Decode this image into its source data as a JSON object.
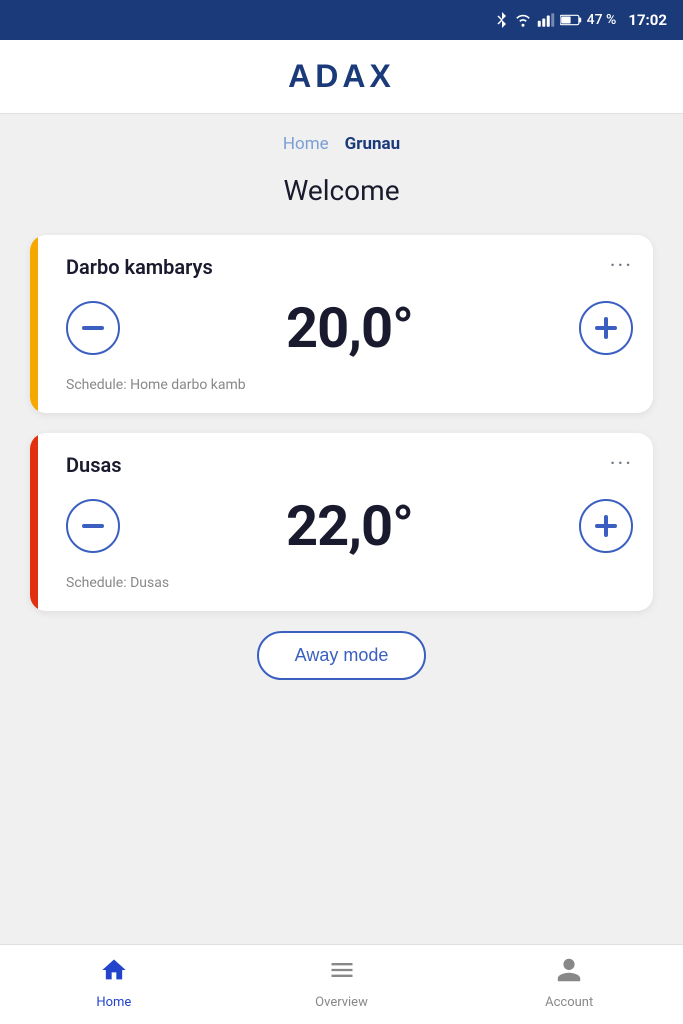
{
  "statusBar": {
    "battery": "47 %",
    "time": "17:02"
  },
  "header": {
    "logo": "ADAX"
  },
  "breadcrumb": {
    "items": [
      {
        "label": "Home",
        "active": false
      },
      {
        "label": "Grunau",
        "active": true
      }
    ]
  },
  "welcome": {
    "title": "Welcome"
  },
  "devices": [
    {
      "id": "device-1",
      "name": "Darbo kambarys",
      "temperature": "20,0°",
      "schedule": "Schedule: Home darbo kamb",
      "accentColor": "#f5a800"
    },
    {
      "id": "device-2",
      "name": "Dusas",
      "temperature": "22,0°",
      "schedule": "Schedule: Dusas",
      "accentColor": "#e03010"
    }
  ],
  "awayMode": {
    "label": "Away mode"
  },
  "bottomNav": {
    "items": [
      {
        "id": "home",
        "label": "Home",
        "active": true
      },
      {
        "id": "overview",
        "label": "Overview",
        "active": false
      },
      {
        "id": "account",
        "label": "Account",
        "active": false
      }
    ]
  }
}
